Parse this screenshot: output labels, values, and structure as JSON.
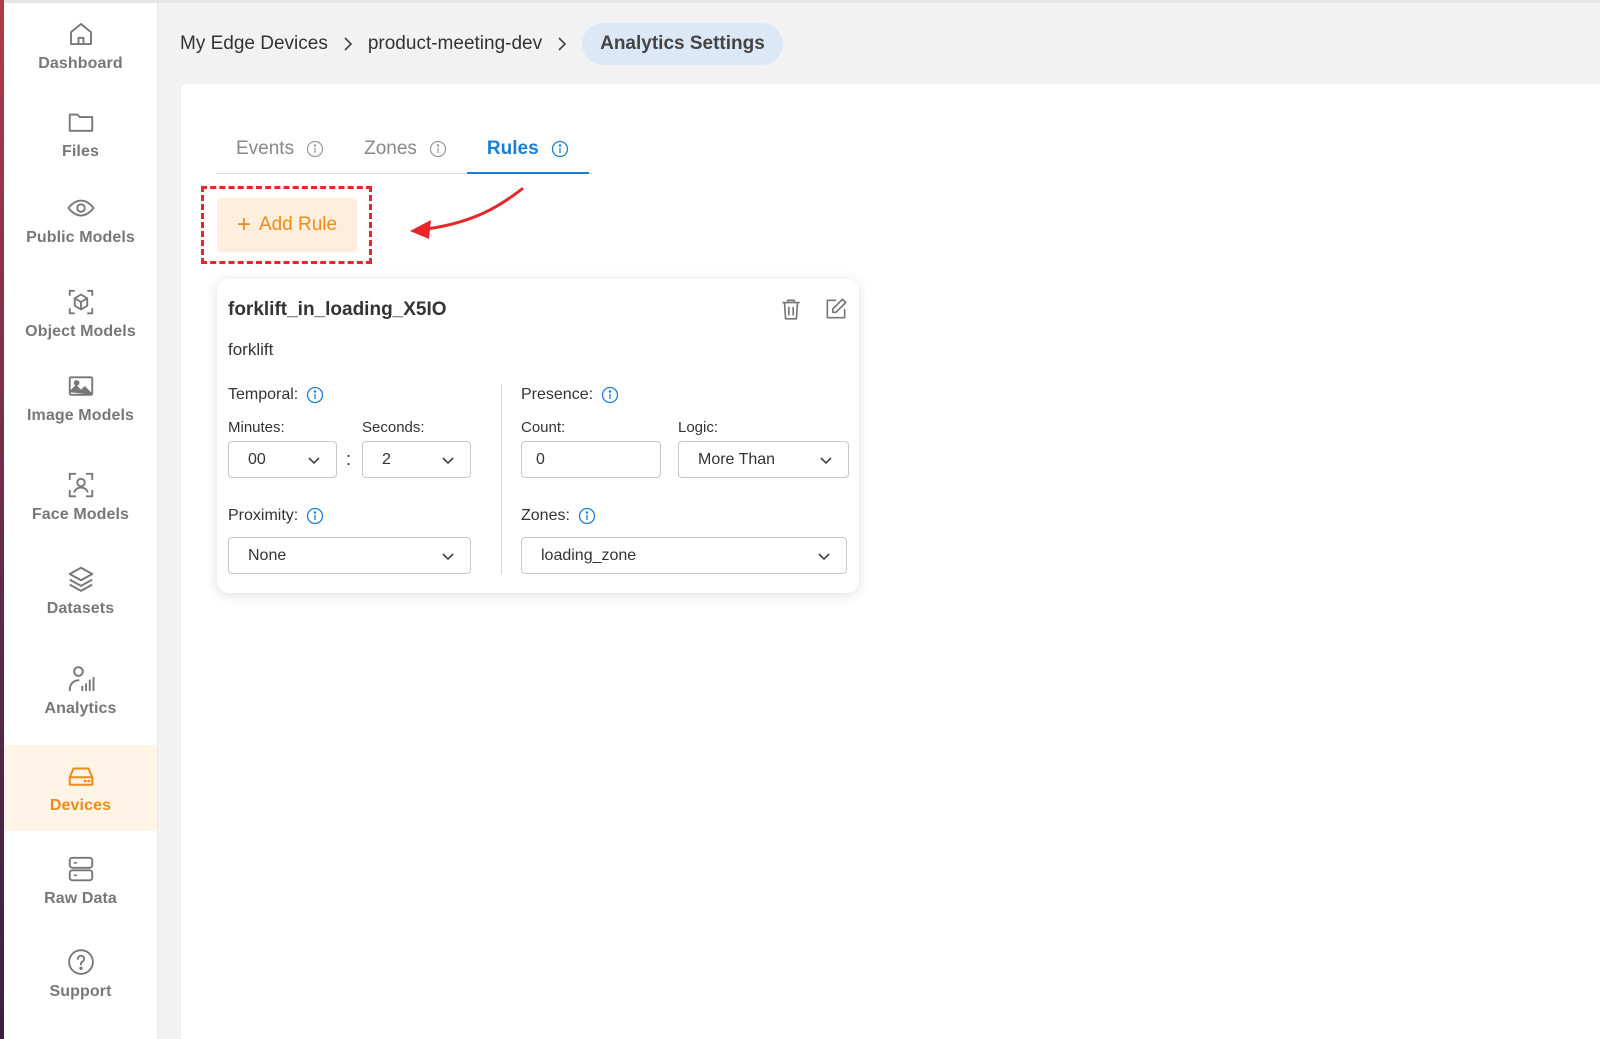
{
  "sidebar": {
    "items": [
      {
        "label": "Dashboard",
        "icon": "home-icon",
        "active": false
      },
      {
        "label": "Files",
        "icon": "folder-icon",
        "active": false
      },
      {
        "label": "Public Models",
        "icon": "eye-icon",
        "active": false
      },
      {
        "label": "Object Models",
        "icon": "cube-icon",
        "active": false
      },
      {
        "label": "Image Models",
        "icon": "image-icon",
        "active": false
      },
      {
        "label": "Face Models",
        "icon": "face-scan-icon",
        "active": false
      },
      {
        "label": "Datasets",
        "icon": "layers-icon",
        "active": false
      },
      {
        "label": "Analytics",
        "icon": "analytics-icon",
        "active": false
      },
      {
        "label": "Devices",
        "icon": "device-icon",
        "active": true
      },
      {
        "label": "Raw Data",
        "icon": "server-icon",
        "active": false
      },
      {
        "label": "Support",
        "icon": "help-icon",
        "active": false
      }
    ]
  },
  "breadcrumb": {
    "items": [
      "My Edge Devices",
      "product-meeting-dev"
    ],
    "current": "Analytics Settings"
  },
  "tabs": [
    {
      "label": "Events",
      "active": false
    },
    {
      "label": "Zones",
      "active": false
    },
    {
      "label": "Rules",
      "active": true
    }
  ],
  "add_rule": {
    "label": "Add Rule"
  },
  "rule_card": {
    "title": "forklift_in_loading_X5IO",
    "subtitle": "forklift",
    "temporal": {
      "label": "Temporal:",
      "minutes_label": "Minutes:",
      "minutes_value": "00",
      "separator": ":",
      "seconds_label": "Seconds:",
      "seconds_value": "2"
    },
    "proximity": {
      "label": "Proximity:",
      "value": "None"
    },
    "presence": {
      "label": "Presence:",
      "count_label": "Count:",
      "count_value": "0",
      "logic_label": "Logic:",
      "logic_value": "More Than"
    },
    "zones": {
      "label": "Zones:",
      "value": "loading_zone"
    }
  },
  "colors": {
    "accent_orange": "#f08a18",
    "accent_blue": "#1a7fd4",
    "highlight_red": "#e5262a",
    "active_nav_bg": "#fff4e6",
    "breadcrumb_current_bg": "#dde8f6"
  }
}
